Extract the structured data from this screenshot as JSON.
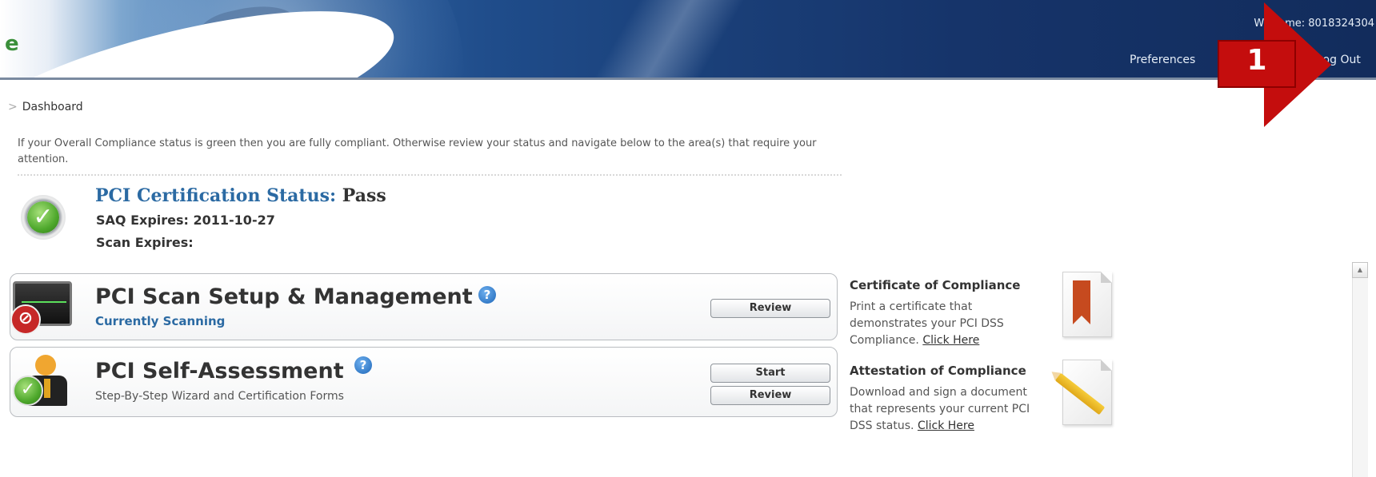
{
  "header": {
    "logo_fragment": "e",
    "welcome": "Welcome: 8018324304",
    "nav": {
      "preferences": "Preferences",
      "separator": "|",
      "logout": "Log Out"
    }
  },
  "annotation": {
    "number": "1",
    "color": "#c40d0d"
  },
  "breadcrumb": {
    "chevron": ">",
    "label": "Dashboard"
  },
  "intro": {
    "text": "If your Overall Compliance status is green then you are fully compliant. Otherwise review your status and navigate below to the area(s) that require your attention."
  },
  "status": {
    "icon": "check-circle-icon",
    "title_label": "PCI Certification Status:",
    "title_value": "Pass",
    "saq_expires": "SAQ Expires: 2011-10-27",
    "scan_expires": "Scan Expires:"
  },
  "panels": [
    {
      "icon": "scan-monitor-icon",
      "title": "PCI Scan Setup & Management",
      "help_icon": "?",
      "subtitle": "Currently Scanning",
      "buttons": [
        "Review"
      ]
    },
    {
      "icon": "self-assessment-person-icon",
      "title": "PCI Self-Assessment",
      "help_icon": "?",
      "subtitle": "Step-By-Step Wizard and Certification Forms",
      "buttons": [
        "Start",
        "Review"
      ]
    }
  ],
  "right": {
    "certificate": {
      "title": "Certificate of Compliance",
      "text": "Print a certificate that demonstrates your PCI DSS Compliance.",
      "link": "Click Here",
      "icon": "certificate-document-icon"
    },
    "attestation": {
      "title": "Attestation of Compliance",
      "text": "Download and sign a document that represents your current PCI DSS status.",
      "link": "Click Here",
      "icon": "attestation-pencil-document-icon"
    }
  },
  "scrollbar": {
    "up_arrow": "▲"
  },
  "colors": {
    "link_blue": "#2b6aa3",
    "header_navy": "#16346a",
    "status_green": "#4ea82c"
  }
}
